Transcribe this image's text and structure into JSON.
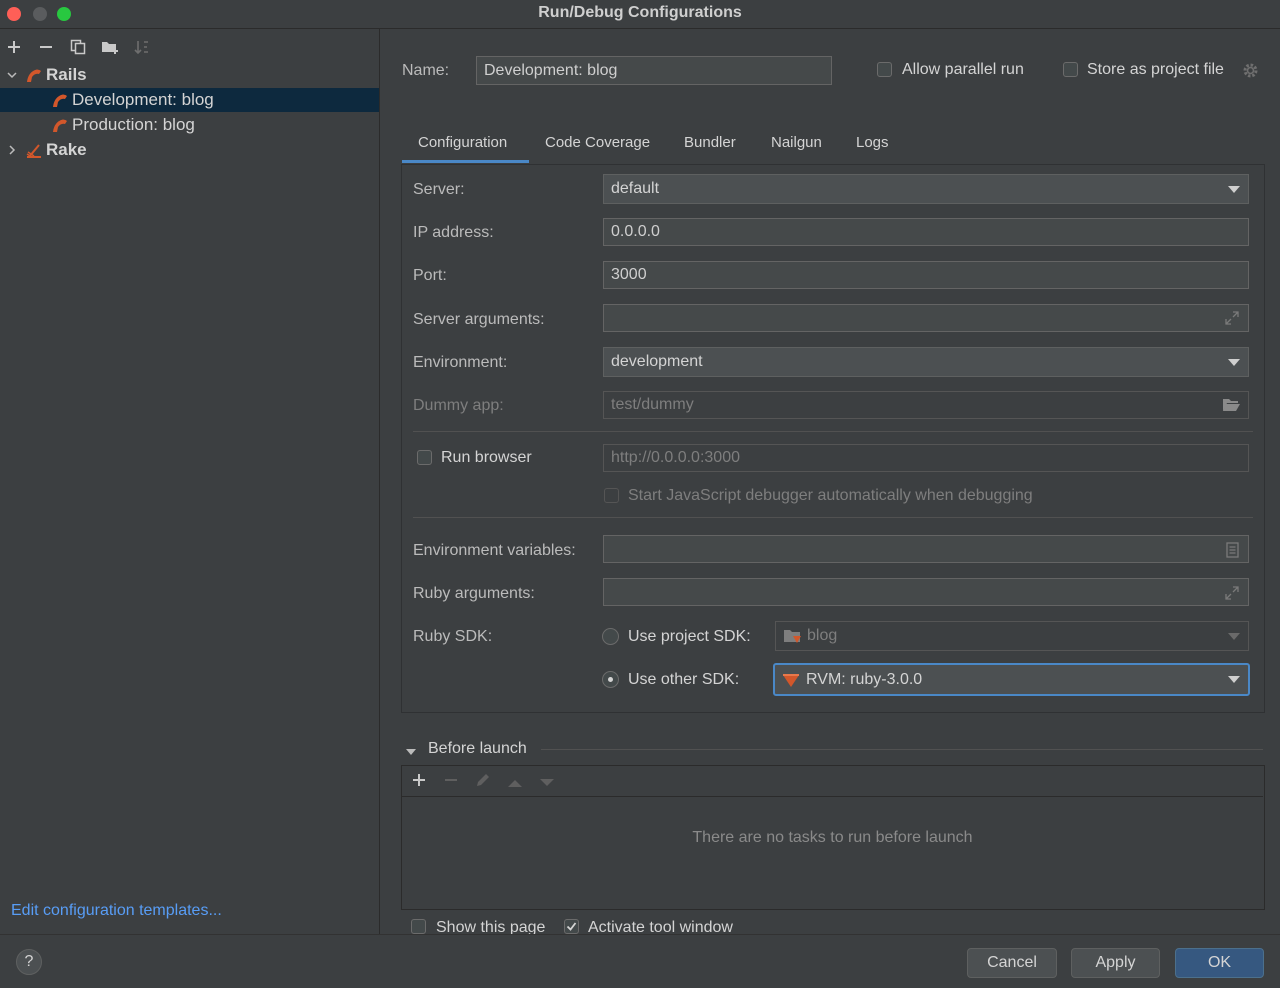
{
  "window": {
    "title": "Run/Debug Configurations"
  },
  "toolbar": {
    "icons": [
      "plus-icon",
      "minus-icon",
      "copy-icon",
      "folder-add-icon",
      "sort-icon"
    ]
  },
  "tree": {
    "groups": [
      {
        "label": "Rails",
        "expanded": true,
        "children": [
          "Development: blog",
          "Production: blog"
        ]
      },
      {
        "label": "Rake",
        "expanded": false
      }
    ],
    "selected": "Development: blog"
  },
  "edit_templates_link": "Edit configuration templates...",
  "help_label": "?",
  "header": {
    "name_label": "Name:",
    "name_value": "Development: blog",
    "allow_parallel_label": "Allow parallel run",
    "store_project_label": "Store as project file"
  },
  "tabs": [
    "Configuration",
    "Code Coverage",
    "Bundler",
    "Nailgun",
    "Logs"
  ],
  "active_tab": "Configuration",
  "form": {
    "server_label": "Server:",
    "server_value": "default",
    "ip_label": "IP address:",
    "ip_value": "0.0.0.0",
    "port_label": "Port:",
    "port_value": "3000",
    "server_args_label": "Server arguments:",
    "environment_label": "Environment:",
    "environment_value": "development",
    "dummy_label": "Dummy app:",
    "dummy_value": "test/dummy",
    "run_browser_label": "Run browser",
    "run_browser_url": "http://0.0.0.0:3000",
    "js_debugger_label": "Start JavaScript debugger automatically when debugging",
    "env_vars_label": "Environment variables:",
    "ruby_args_label": "Ruby arguments:",
    "ruby_sdk_label": "Ruby SDK:",
    "use_project_sdk_label": "Use project SDK:",
    "project_sdk_value": "blog",
    "use_other_sdk_label": "Use other SDK:",
    "other_sdk_value": "RVM: ruby-3.0.0"
  },
  "before_launch": {
    "title": "Before launch",
    "empty_text": "There are no tasks to run before launch"
  },
  "footer": {
    "show_page_label": "Show this page",
    "activate_tool_label": "Activate tool window",
    "cancel_label": "Cancel",
    "apply_label": "Apply",
    "ok_label": "OK"
  },
  "colors": {
    "accent": "#4a88c7",
    "selection": "#0d293e",
    "ruby": "#d2572b",
    "ok_button": "#365880"
  }
}
